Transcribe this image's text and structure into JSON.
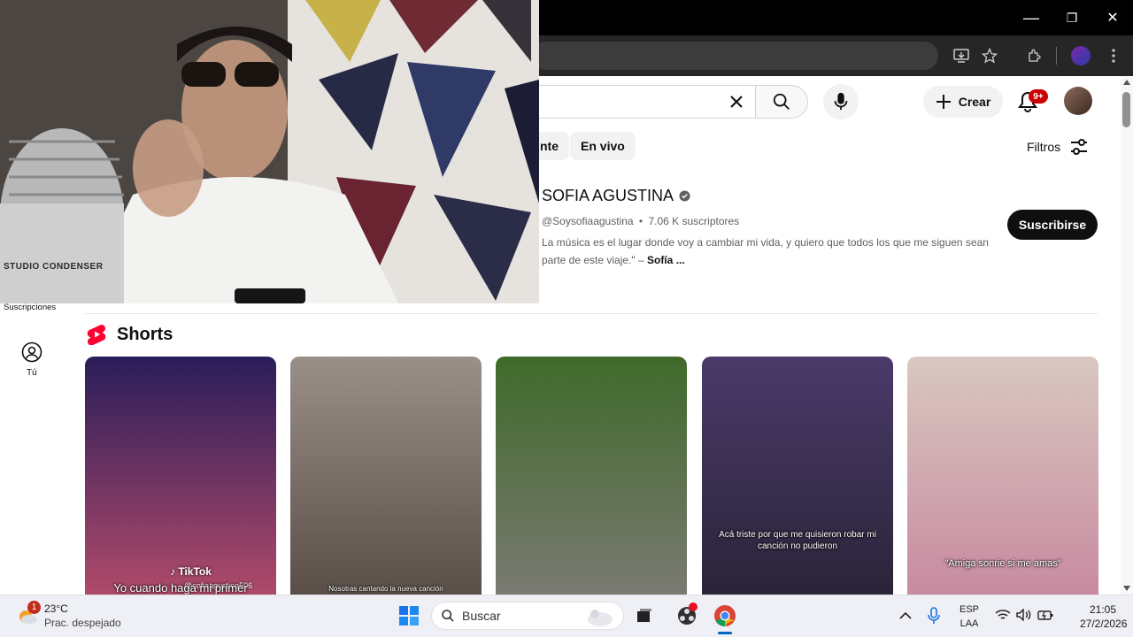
{
  "browser": {
    "window_controls": {
      "minimize": "—",
      "restore": "❐",
      "close": "✕"
    }
  },
  "header": {
    "create_label": "Crear",
    "notification_count": "9+"
  },
  "chips": [
    "nte",
    "En vivo"
  ],
  "filters_label": "Filtros",
  "channel": {
    "name": "SOFIA AGUSTINA",
    "handle": "@Soysofiaagustina",
    "separator": "•",
    "subscribers": "7.06 K suscriptores",
    "description": "La música es el lugar donde voy a cambiar mi vida, y quiero que todos los que me siguen sean parte de este viaje.\" –",
    "description_author": "Sofía ...",
    "subscribe_label": "Suscribirse"
  },
  "sidebar": {
    "subscriptions_label": "Suscripciones",
    "you_label": "Tú"
  },
  "shorts": {
    "section_title": "Shorts",
    "items": [
      {
        "caption": "Yo cuando haga mi primer",
        "watermark": "TikTok",
        "handle": "@sofiaagustina506",
        "colors": [
          "#2a1d5a",
          "#b04a6a"
        ]
      },
      {
        "caption": "Nosotras cantando la nueva canción",
        "colors": [
          "#9a9088",
          "#5a4e48"
        ]
      },
      {
        "caption": "",
        "colors": [
          "#3f6a2a",
          "#7a7a72"
        ]
      },
      {
        "caption": "Acá triste por que me quisieron robar mi canción no pudieron",
        "colors": [
          "#4a3a6a",
          "#2a2438"
        ]
      },
      {
        "caption": "\"Amiga sonrie si me amas\"",
        "colors": [
          "#d8c8c0",
          "#c88aa0"
        ]
      }
    ]
  },
  "webcam": {
    "mic_label": "STUDIO CONDENSER"
  },
  "taskbar": {
    "weather_badge": "1",
    "temperature": "23°C",
    "weather_desc": "Prac. despejado",
    "search_placeholder": "Buscar",
    "lang_primary": "ESP",
    "lang_secondary": "LAA",
    "time": "21:05",
    "date": "27/2/2026"
  },
  "colors": {
    "yt_red": "#ff0033",
    "subscribe_bg": "#0f0f0f",
    "chip_bg": "#f2f2f2"
  }
}
